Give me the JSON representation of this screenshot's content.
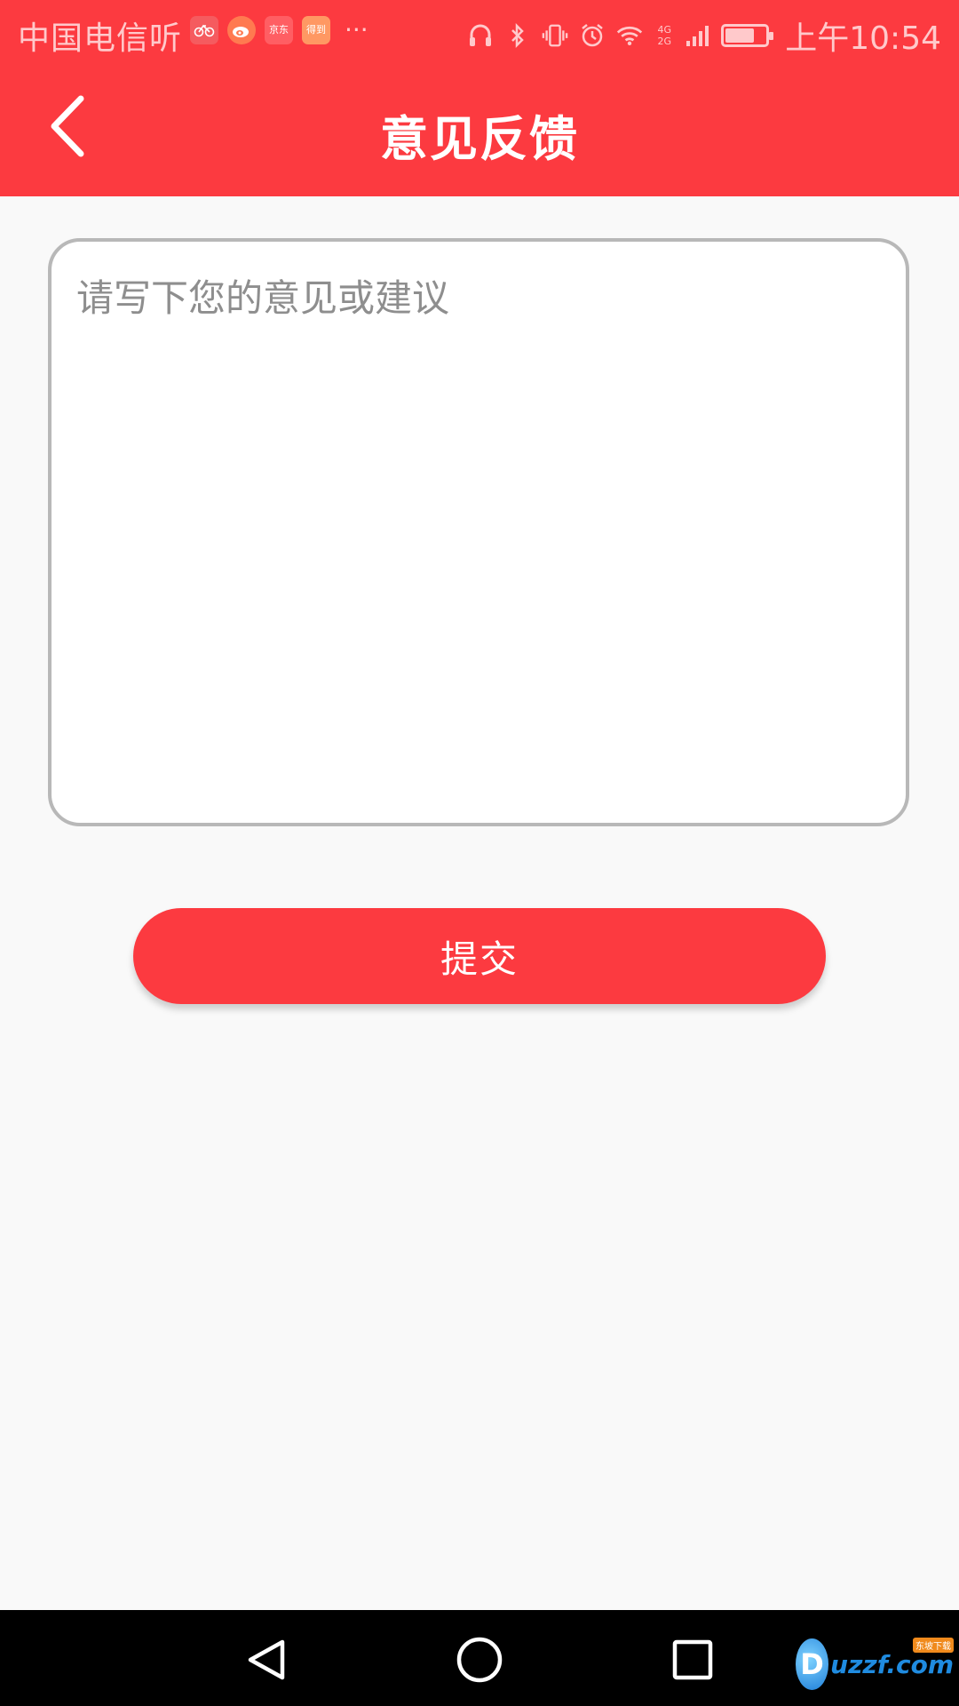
{
  "status_bar": {
    "carrier": "中国电信听",
    "notification_icons": [
      "bike-app-icon",
      "weibo-icon",
      "jd-icon",
      "doc-app-icon"
    ],
    "notif_jd_label": "京东",
    "notif_doc_label": "得到",
    "more": "···",
    "network_label_top": "4G",
    "network_label_bottom": "2G",
    "battery_level": 0.75,
    "time": "上午10:54"
  },
  "header": {
    "back_icon": "chevron-left-icon",
    "title": "意见反馈"
  },
  "feedback": {
    "placeholder": "请写下您的意见或建议",
    "value": ""
  },
  "submit": {
    "label": "提交"
  },
  "nav_bar": {
    "buttons": [
      "back-triangle-icon",
      "home-circle-icon",
      "recent-square-icon"
    ]
  },
  "watermark": {
    "text": "uzzf.com",
    "tag": "东坡下载"
  },
  "colors": {
    "primary": "#fc3a40",
    "background": "#f9f9f9",
    "border": "#b8b8b8",
    "placeholder": "#8e8e8e"
  }
}
